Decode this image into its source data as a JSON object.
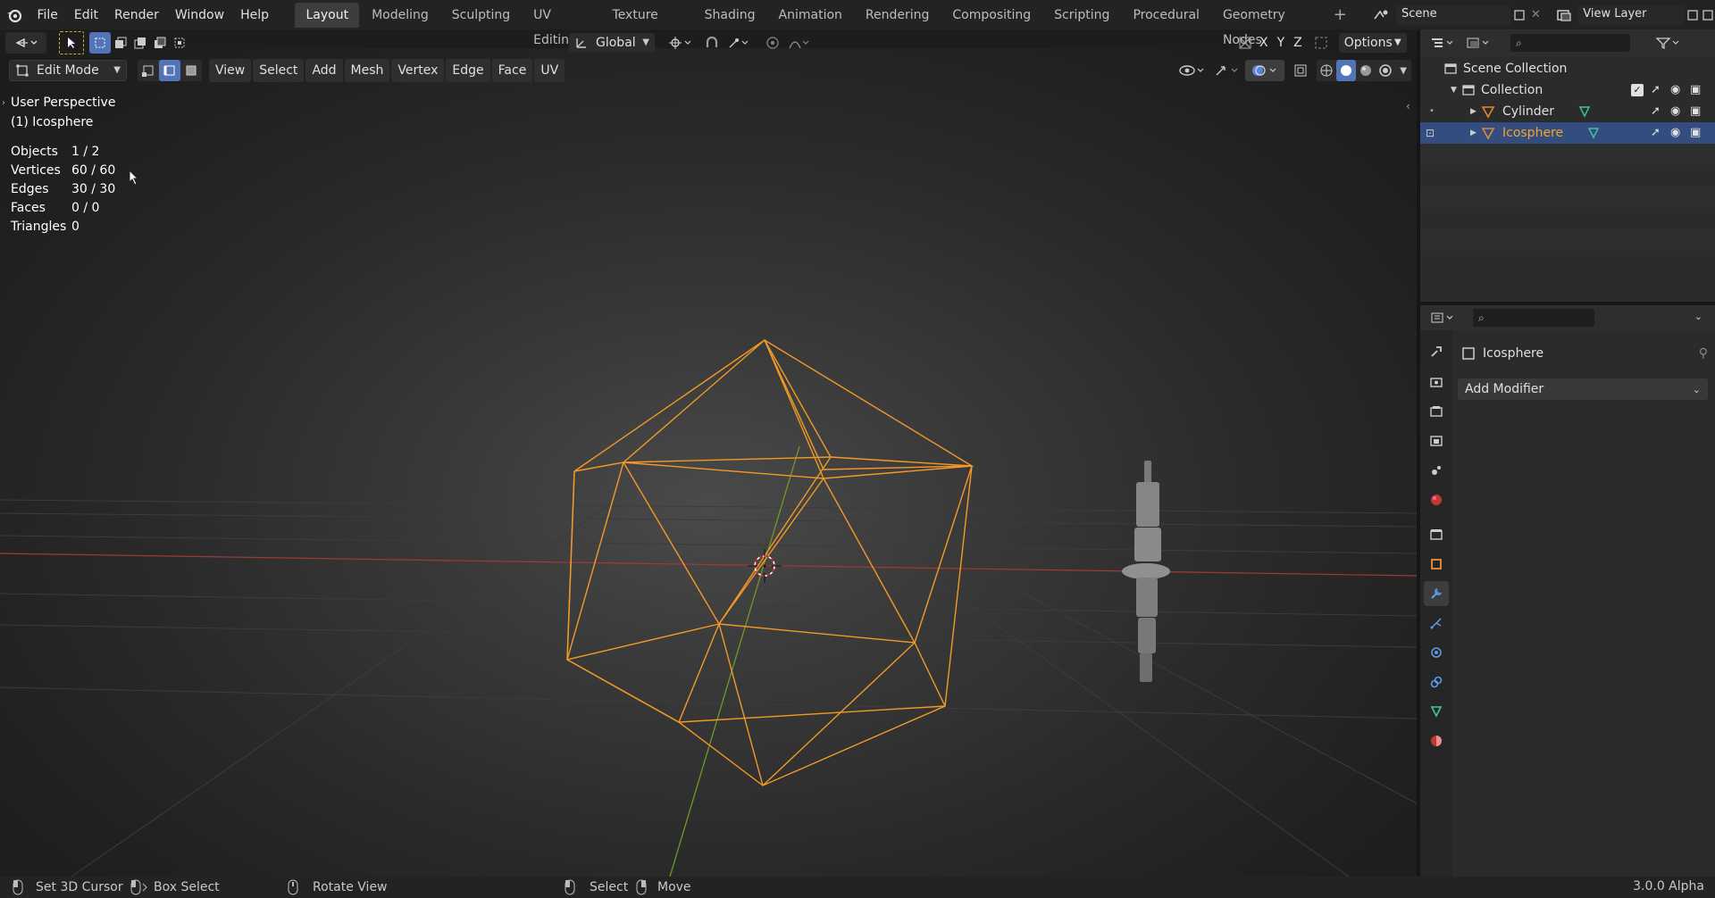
{
  "topbar": {
    "menus": [
      "File",
      "Edit",
      "Render",
      "Window",
      "Help"
    ],
    "workspaces": [
      "Layout",
      "Modeling",
      "Sculpting",
      "UV Editing",
      "Texture Paint",
      "Shading",
      "Animation",
      "Rendering",
      "Compositing",
      "Scripting",
      "Procedural",
      "Geometry Nodes"
    ],
    "active_workspace": "Layout",
    "add_label": "+",
    "scene": "Scene",
    "view_layer": "View Layer"
  },
  "tool_header": {
    "orientation": "Global",
    "axes": [
      "X",
      "Y",
      "Z"
    ],
    "options": "Options"
  },
  "vp_header": {
    "mode": "Edit Mode",
    "menus": [
      "View",
      "Select",
      "Add",
      "Mesh",
      "Vertex",
      "Edge",
      "Face",
      "UV"
    ]
  },
  "overlay": {
    "perspective": "User Perspective",
    "object_name": "(1) Icosphere",
    "stats": [
      {
        "label": "Objects",
        "value": "1 / 2"
      },
      {
        "label": "Vertices",
        "value": "60 / 60"
      },
      {
        "label": "Edges",
        "value": "30 / 30"
      },
      {
        "label": "Faces",
        "value": "0 / 0"
      },
      {
        "label": "Triangles",
        "value": "0"
      }
    ]
  },
  "outliner": {
    "scene_collection": "Scene Collection",
    "collection": "Collection",
    "objects": [
      {
        "name": "Cylinder",
        "selected": false
      },
      {
        "name": "Icosphere",
        "selected": true
      }
    ]
  },
  "properties": {
    "object_name": "Icosphere",
    "add_modifier": "Add Modifier"
  },
  "statusbar": {
    "items": [
      "Set 3D Cursor",
      "Box Select",
      "Rotate View",
      "Select",
      "Move"
    ],
    "version": "3.0.0 Alpha"
  },
  "colors": {
    "accent_orange": "#f5a623",
    "wire": "#f29a25",
    "selected_row": "#334d80",
    "axis_x": "#a03a3a",
    "axis_y": "#6b9a2c"
  }
}
